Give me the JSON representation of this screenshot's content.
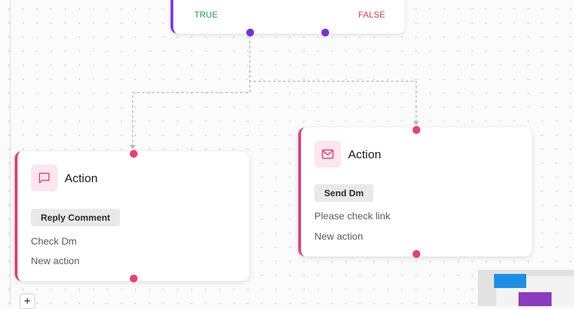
{
  "condition_node": {
    "true_label": "TRUE",
    "false_label": "FALSE"
  },
  "action_nodes": [
    {
      "icon": "message-square-icon",
      "title": "Action",
      "badge": "Reply Comment",
      "line1": "Check Dm",
      "line2": "New action"
    },
    {
      "icon": "mail-icon",
      "title": "Action",
      "badge": "Send Dm",
      "line1": "Please check link",
      "line2": "New action"
    }
  ],
  "controls": {
    "zoom_in_label": "+"
  },
  "colors": {
    "condition_accent": "#7c3aed",
    "action_accent": "#e0407a",
    "true_color": "#1a9a3c",
    "false_color": "#d23b3b",
    "minimap_blue": "#1d8fe6",
    "minimap_purple": "#8a3bbf"
  }
}
